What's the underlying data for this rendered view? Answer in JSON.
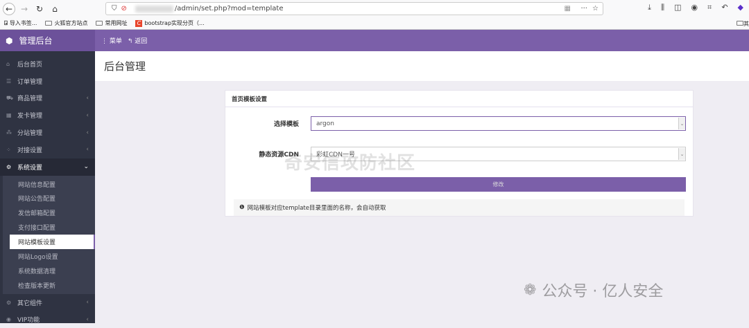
{
  "browser": {
    "url": "/admin/set.php?mod=template",
    "bookmarks": [
      "导入书签...",
      "火狐官方站点",
      "常用网址",
      "bootstrap实现分页（..."
    ],
    "bookmark_right": "其"
  },
  "header": {
    "brand": "管理后台",
    "menu": "菜单",
    "back": "返回"
  },
  "sidebar": {
    "items": [
      {
        "label": "后台首页",
        "icon": "home-icon"
      },
      {
        "label": "订单管理",
        "icon": "list-icon"
      },
      {
        "label": "商品管理",
        "icon": "cart-icon"
      },
      {
        "label": "发卡管理",
        "icon": "grid-icon"
      },
      {
        "label": "分站管理",
        "icon": "sitemap-icon"
      },
      {
        "label": "对接设置",
        "icon": "cubes-icon"
      },
      {
        "label": "系统设置",
        "icon": "gear-icon"
      }
    ],
    "sub": [
      "网站信息配置",
      "网站公告配置",
      "发信邮箱配置",
      "支付接口配置",
      "网站模板设置",
      "网站Logo设置",
      "系统数据清理",
      "检查版本更新"
    ],
    "bottom": [
      {
        "label": "其它组件",
        "icon": "gears-icon"
      },
      {
        "label": "VIP功能",
        "icon": "user-icon"
      }
    ]
  },
  "page": {
    "title": "后台管理"
  },
  "card": {
    "title": "首页模板设置",
    "template_label": "选择模板",
    "template_value": "argon",
    "cdn_label": "静态资源CDN",
    "cdn_value": "彩虹CDN一号",
    "submit": "修改",
    "note": "网站模板对应template目录里面的名称，会自动获取"
  },
  "watermarks": {
    "a": "奇安信攻防社区",
    "b": "公众号 · 亿人安全"
  },
  "colors": {
    "accent": "#7b5fa9",
    "sidebar": "#2f3342"
  }
}
